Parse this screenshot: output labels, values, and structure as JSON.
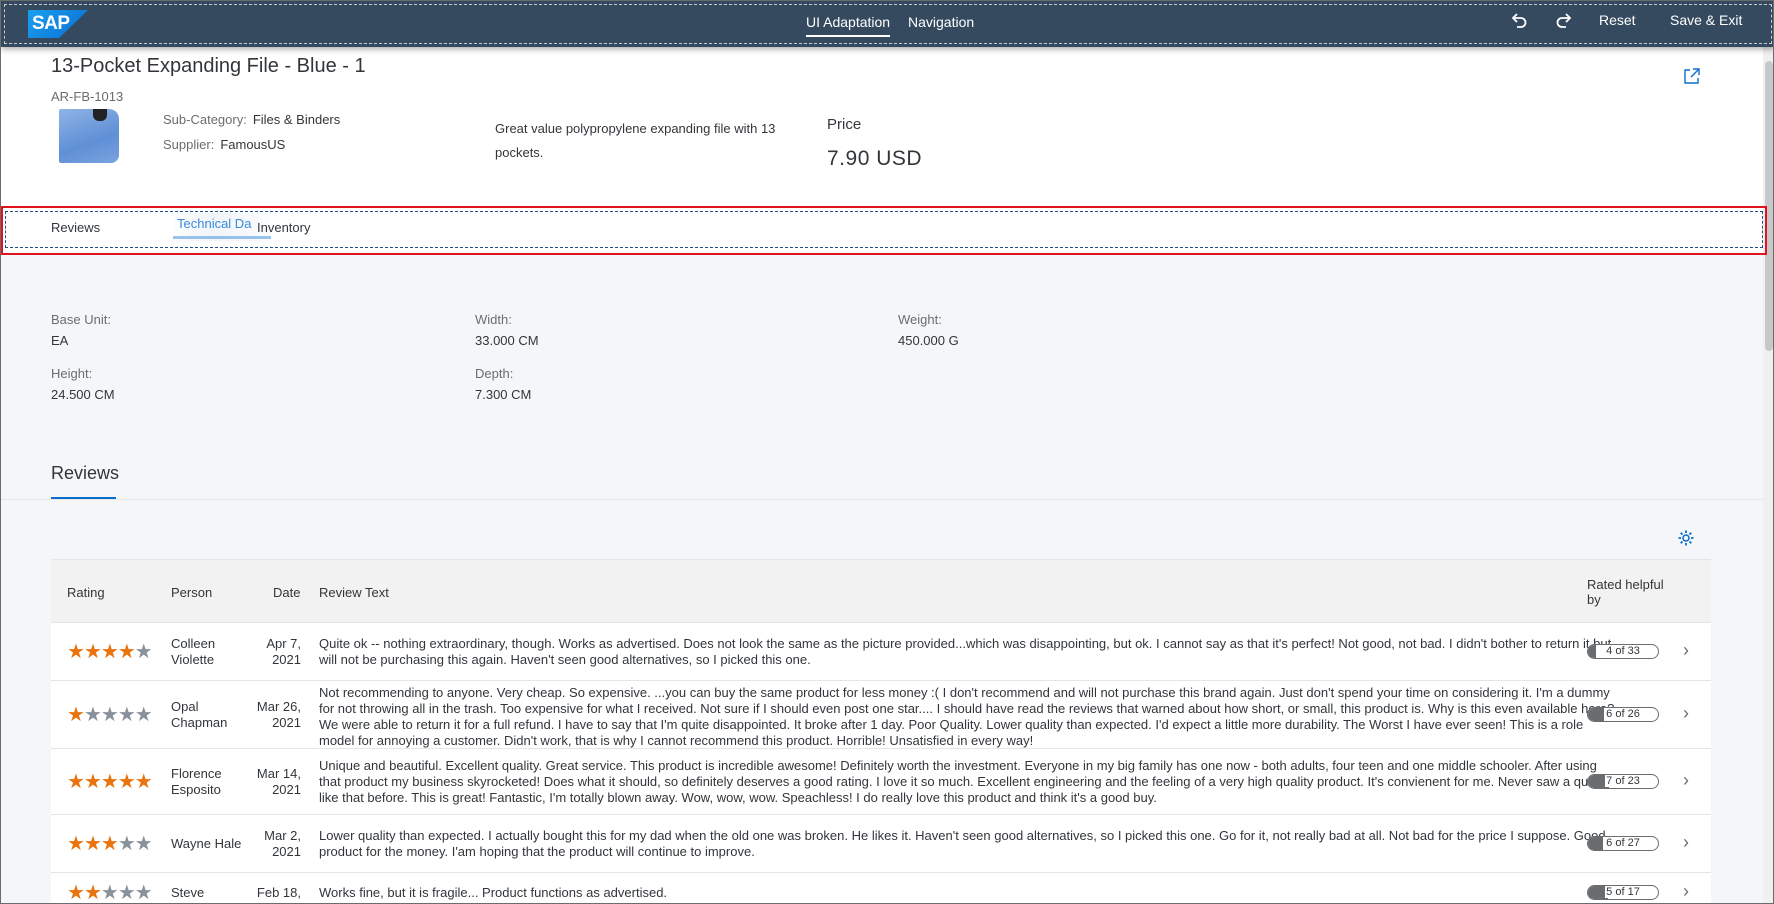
{
  "toolbar": {
    "logo": "SAP",
    "tabs": [
      {
        "label": "UI Adaptation"
      },
      {
        "label": "Navigation"
      }
    ],
    "reset_label": "Reset",
    "save_exit_label": "Save & Exit"
  },
  "header": {
    "title": "13-Pocket Expanding File - Blue - 1",
    "subtitle": "AR-FB-1013",
    "subcategory_label": "Sub-Category:",
    "subcategory_value": "Files & Binders",
    "supplier_label": "Supplier:",
    "supplier_value": "FamousUS",
    "description": "Great value polypropylene expanding file with 13 pockets.",
    "price_label": "Price",
    "price_value": "7.90  USD"
  },
  "anchor_bar": {
    "items": [
      {
        "label": "Reviews"
      },
      {
        "label": "Inventory"
      }
    ],
    "dragged_label": "Technical Da"
  },
  "technical": {
    "base_unit_label": "Base Unit:",
    "base_unit_value": "EA",
    "width_label": "Width:",
    "width_value": "33.000 CM",
    "weight_label": "Weight:",
    "weight_value": "450.000 G",
    "height_label": "Height:",
    "height_value": "24.500 CM",
    "depth_label": "Depth:",
    "depth_value": "7.300 CM"
  },
  "reviews": {
    "title": "Reviews",
    "columns": {
      "rating": "Rating",
      "person": "Person",
      "date": "Date",
      "text": "Review Text",
      "helpful": "Rated helpful by"
    },
    "rows": [
      {
        "rating": 4,
        "person": "Colleen Violette",
        "date": "Apr 7, 2021",
        "text": "Quite ok -- nothing extraordinary, though. Works as advertised. Does not look the same as the picture provided...which was disappointing, but ok. I cannot say as that it's perfect! Not good, not bad. I didn't bother to return it but will not be purchasing this again. Haven't seen good alternatives, so I picked this one.",
        "helpful": "4 of 33",
        "helpful_fraction": 0.12
      },
      {
        "rating": 1,
        "person": "Opal Chapman",
        "date": "Mar 26, 2021",
        "text": "Not recommending to anyone. Very cheap. So expensive. ...you can buy the same product for less money :( I don't recommend and will not purchase this brand again. Just don't spend your time on considering it. I'm a dummy for not throwing all in the trash. Too expensive for what I received. Not sure if I should even post one star.... I should have read the reviews that warned about how short, or small, this product is. Why is this even available here? We were able to return it for a full refund. I have to say that I'm quite disappointed. It broke after 1 day. Poor Quality. Lower quality than expected. I'd expect a little more durability. The Worst I have ever seen! This is a role model for annoying a customer. Didn't work, that is why I cannot recommend this product. Horrible! Unsatisfied in every way!",
        "helpful": "6 of 26",
        "helpful_fraction": 0.23
      },
      {
        "rating": 5,
        "person": "Florence Esposito",
        "date": "Mar 14, 2021",
        "text": "Unique and beautiful. Excellent quality. Great service. This product is incredible awesome! Definitely worth the investment. Everyone in my big family has one now - both adults, four teen and one middle schooler. After using that product my business skyrocketed! Does what it should, so definitely deserves a good rating. I love it so much. Excellent engineering and the feeling of a very high quality product. It's convienent for me. Never saw a quality like that before. This is great! Fantastic, I'm totally blown away. Wow, wow, wow. Speachless! I do really love this product and think it's a good buy.",
        "helpful": "7 of 23",
        "helpful_fraction": 0.3
      },
      {
        "rating": 3,
        "person": "Wayne Hale",
        "date": "Mar 2, 2021",
        "text": "Lower quality than expected. I actually bought this for my dad when the old one was broken. He likes it. Haven't seen good alternatives, so I picked this one. Go for it, not really bad at all. Not bad for the price I suppose. Good product for the money. I'am hoping that the product will continue to improve.",
        "helpful": "6 of 27",
        "helpful_fraction": 0.22
      },
      {
        "rating": 2,
        "person": "Steve",
        "date": "Feb 18,",
        "text": "Works fine, but it is fragile... Product functions as advertised.",
        "helpful": "5 of 17",
        "helpful_fraction": 0.29
      }
    ]
  }
}
